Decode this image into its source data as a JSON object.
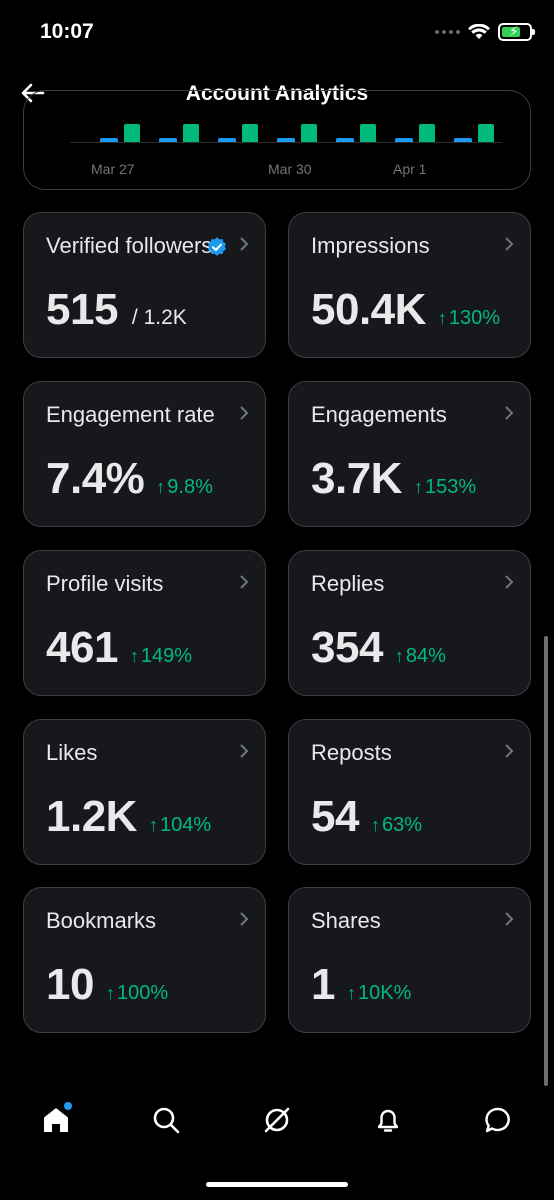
{
  "status_bar": {
    "time": "10:07"
  },
  "header": {
    "title": "Account Analytics"
  },
  "chart": {
    "x_ticks": [
      "Mar 27",
      "Mar 30",
      "Apr 1"
    ],
    "colors": {
      "previous": "#1d9bf0",
      "current": "#00ba7c"
    }
  },
  "cards": [
    {
      "label": "Verified followers",
      "value": "515",
      "sub": "/ 1.2K",
      "change": "",
      "verified": true
    },
    {
      "label": "Impressions",
      "value": "50.4K",
      "sub": "",
      "change": "130%"
    },
    {
      "label": "Engagement rate",
      "value": "7.4%",
      "sub": "",
      "change": "9.8%"
    },
    {
      "label": "Engagements",
      "value": "3.7K",
      "sub": "",
      "change": "153%"
    },
    {
      "label": "Profile visits",
      "value": "461",
      "sub": "",
      "change": "149%"
    },
    {
      "label": "Replies",
      "value": "354",
      "sub": "",
      "change": "84%"
    },
    {
      "label": "Likes",
      "value": "1.2K",
      "sub": "",
      "change": "104%"
    },
    {
      "label": "Reposts",
      "value": "54",
      "sub": "",
      "change": "63%"
    },
    {
      "label": "Bookmarks",
      "value": "10",
      "sub": "",
      "change": "100%"
    },
    {
      "label": "Shares",
      "value": "1",
      "sub": "",
      "change": "10K%"
    }
  ],
  "change_arrow": "↑",
  "tabs": [
    "home-icon",
    "search-icon",
    "grok-icon",
    "notifications-icon",
    "messages-icon"
  ],
  "accent_color": "#1d9bf0",
  "positive_color": "#00ba7c"
}
